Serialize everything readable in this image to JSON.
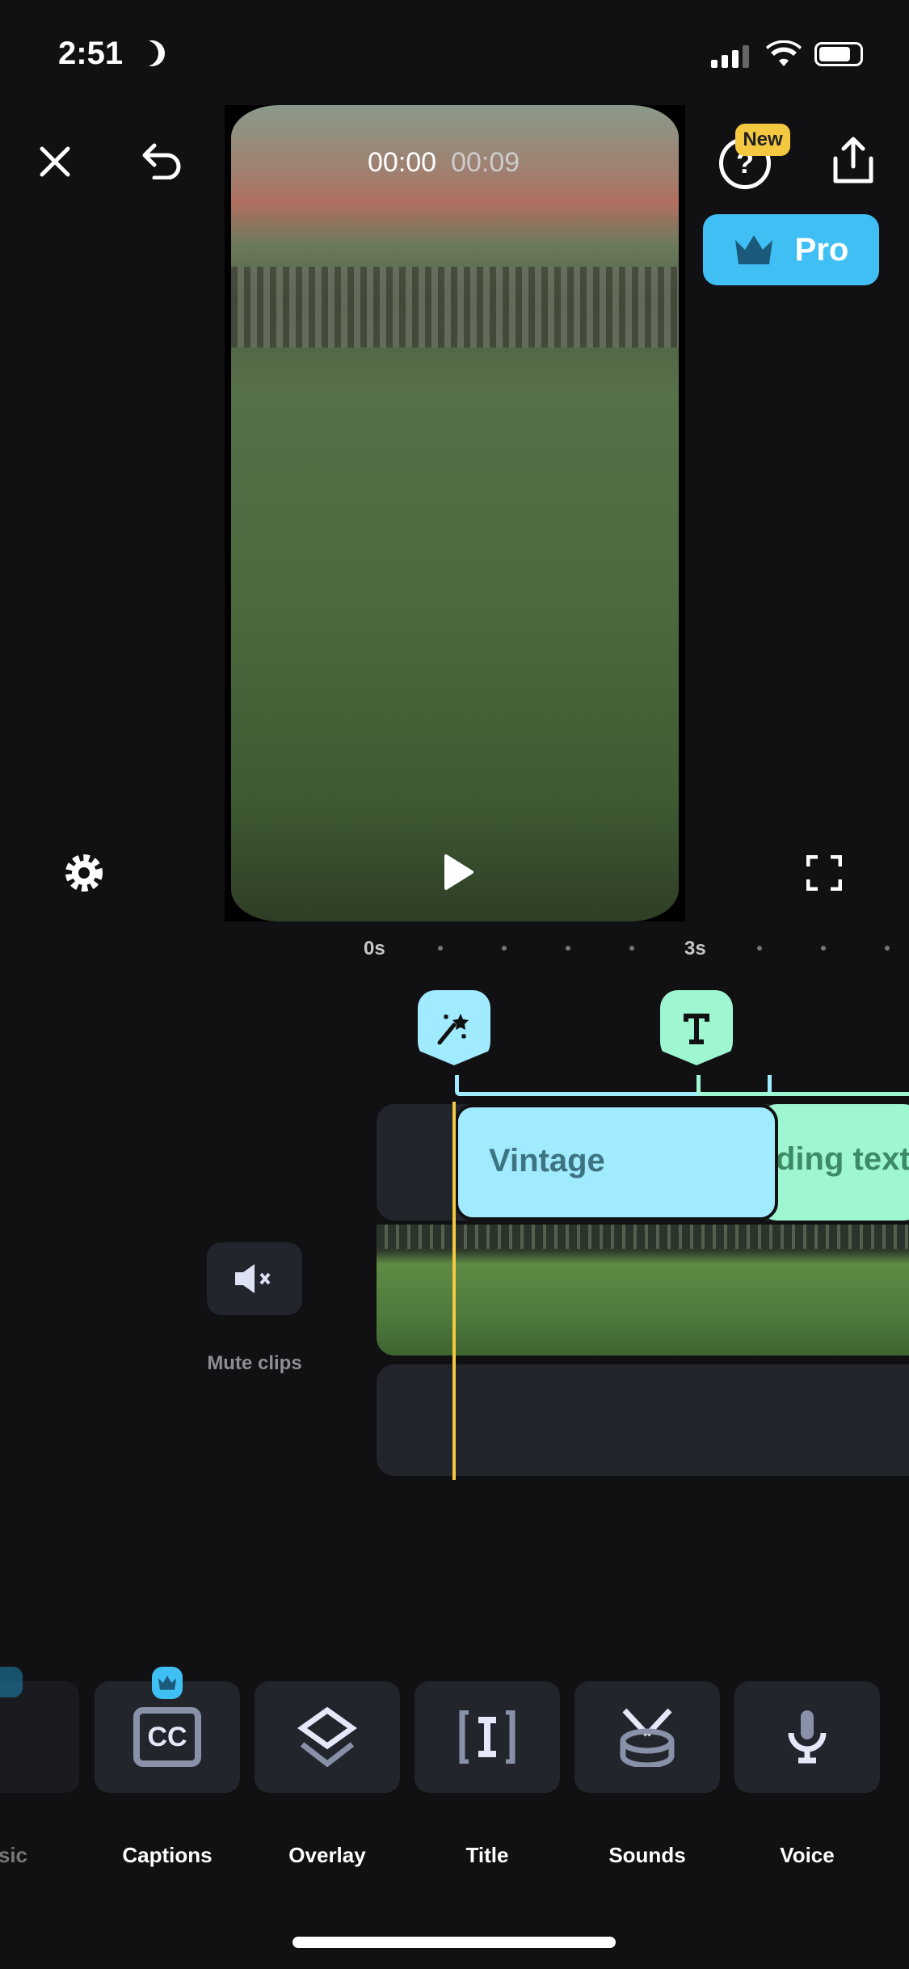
{
  "status": {
    "time": "2:51"
  },
  "player": {
    "current_time": "00:00",
    "duration": "00:09"
  },
  "header": {
    "new_badge": "New",
    "pro_label": "Pro"
  },
  "ruler": {
    "labels": [
      "0s",
      "3s"
    ]
  },
  "timeline": {
    "effect_clip": "Vintage",
    "text_clip": "ding text",
    "mute_label": "Mute clips"
  },
  "toolbar": {
    "items": [
      {
        "label": "usic"
      },
      {
        "label": "Captions"
      },
      {
        "label": "Overlay"
      },
      {
        "label": "Title"
      },
      {
        "label": "Sounds"
      },
      {
        "label": "Voice"
      }
    ]
  },
  "colors": {
    "accent": "#40bff5",
    "effect": "#a0ebff",
    "text_clip": "#9ff7d2",
    "playhead": "#f5c842",
    "new_badge": "#f5c842"
  }
}
